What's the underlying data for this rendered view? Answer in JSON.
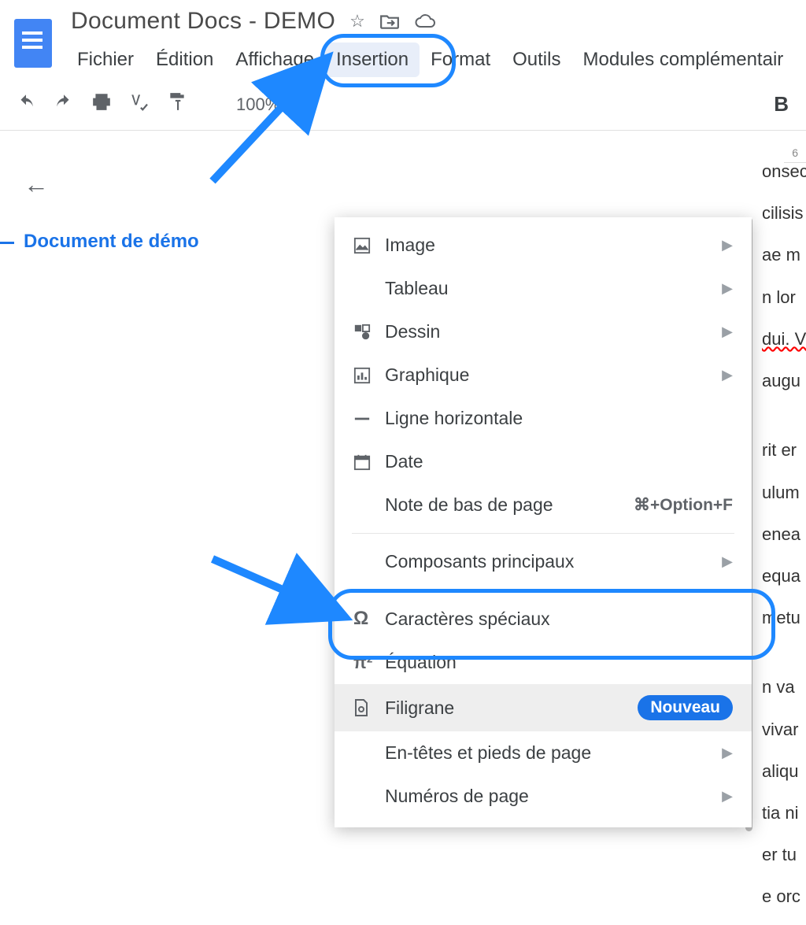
{
  "doc_title": "Document Docs - DEMO",
  "menu": {
    "file": "Fichier",
    "edit": "Édition",
    "view": "Affichage",
    "insert": "Insertion",
    "format": "Format",
    "tools": "Outils",
    "addons": "Modules complémentair"
  },
  "toolbar": {
    "zoom": "100%",
    "bold": "B"
  },
  "ruler_stub": "6",
  "outline": {
    "item1": "Document de démo"
  },
  "dropdown": {
    "image": "Image",
    "table": "Tableau",
    "drawing": "Dessin",
    "chart": "Graphique",
    "hr": "Ligne horizontale",
    "date": "Date",
    "footnote": "Note de bas de page",
    "footnote_shortcut": "⌘+Option+F",
    "building_blocks": "Composants principaux",
    "special_chars": "Caractères spéciaux",
    "equation": "Équation",
    "watermark": "Filigrane",
    "new_badge": "Nouveau",
    "headers_footers": "En-têtes et pieds de page",
    "page_numbers": "Numéros de page"
  },
  "doc_text": {
    "p1": "onsec",
    "p2": "cilisis",
    "p3": "ae m",
    "p4": "n lor",
    "p5": "dui. V",
    "p6": "augu",
    "p7": "rit er",
    "p8": "ulum",
    "p9": "enea",
    "p10": "equa",
    "p11": "metu",
    "p12": "n va",
    "p13": "vivar",
    "p14": "aliqu",
    "p15": "tia ni",
    "p16": "er tu",
    "p17": "e orc"
  }
}
